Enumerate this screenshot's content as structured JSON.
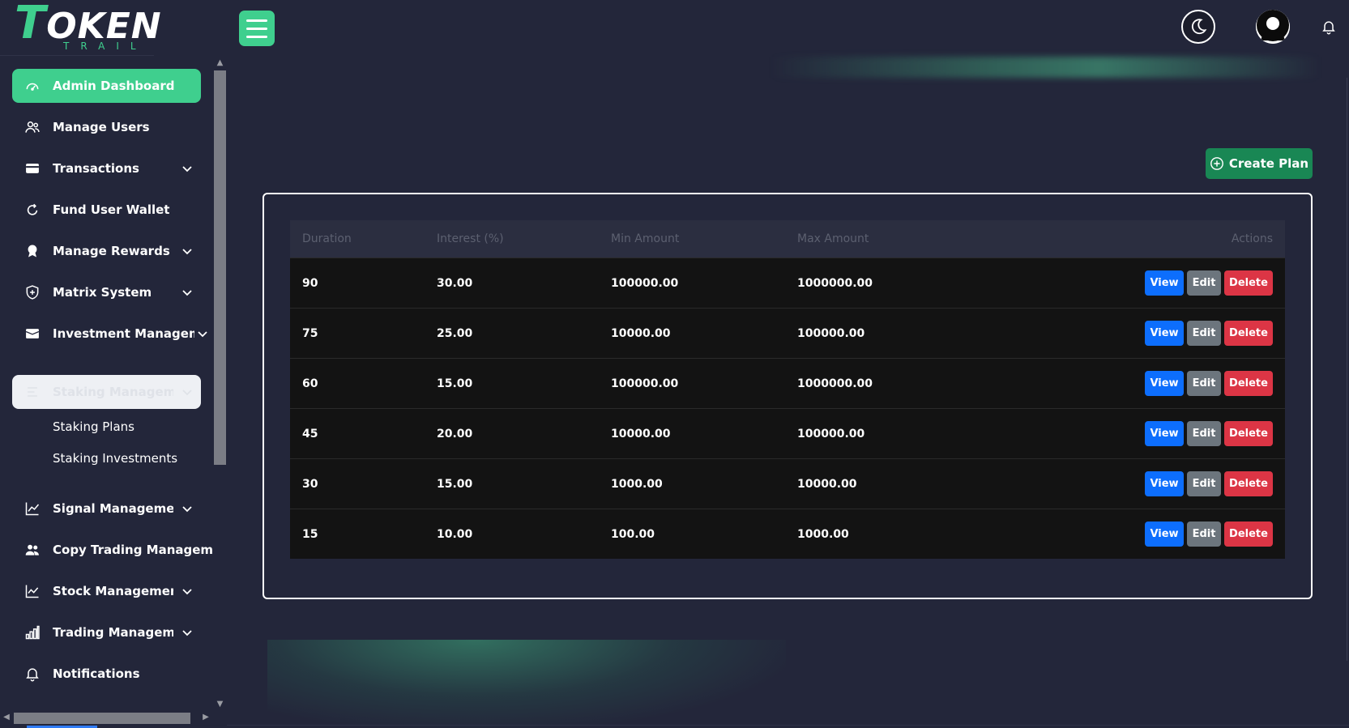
{
  "logo": {
    "main_first": "T",
    "main_rest": "OKEN",
    "sub": "TRAIL"
  },
  "sidebar": {
    "items": [
      {
        "label": "Admin Dashboard",
        "icon": "gauge-icon",
        "chevron": false
      },
      {
        "label": "Manage Users",
        "icon": "users-icon",
        "chevron": false
      },
      {
        "label": "Transactions",
        "icon": "credit-card-icon",
        "chevron": true
      },
      {
        "label": "Fund User Wallet",
        "icon": "refresh-icon",
        "chevron": false
      },
      {
        "label": "Manage Rewards",
        "icon": "award-icon",
        "chevron": true
      },
      {
        "label": "Matrix System",
        "icon": "shield-icon",
        "chevron": true
      },
      {
        "label": "Investment Management",
        "icon": "wallet-icon",
        "chevron": true
      },
      {
        "label": "Staking Management",
        "icon": "list-icon",
        "chevron": true
      },
      {
        "label": "Signal Management",
        "icon": "chart-line-icon",
        "chevron": true
      },
      {
        "label": "Copy Trading Management",
        "icon": "people-icon",
        "chevron": true
      },
      {
        "label": "Stock Management",
        "icon": "stock-chart-icon",
        "chevron": true
      },
      {
        "label": "Trading Management",
        "icon": "bar-chart-icon",
        "chevron": true
      },
      {
        "label": "Notifications",
        "icon": "bell-icon",
        "chevron": false
      }
    ],
    "submenu": [
      "Staking Plans",
      "Staking Investments"
    ]
  },
  "toolbar": {
    "create_label": "Create Plan"
  },
  "table": {
    "headers": [
      "Duration",
      "Interest (%)",
      "Min Amount",
      "Max Amount",
      "Actions"
    ],
    "rows": [
      [
        "90",
        "30.00",
        "100000.00",
        "1000000.00"
      ],
      [
        "75",
        "25.00",
        "10000.00",
        "100000.00"
      ],
      [
        "60",
        "15.00",
        "100000.00",
        "1000000.00"
      ],
      [
        "45",
        "20.00",
        "10000.00",
        "100000.00"
      ],
      [
        "30",
        "15.00",
        "1000.00",
        "10000.00"
      ],
      [
        "15",
        "10.00",
        "100.00",
        "1000.00"
      ]
    ],
    "actions": {
      "view": "View",
      "edit": "Edit",
      "delete": "Delete"
    }
  },
  "colors": {
    "accent": "#3fcf8e",
    "background": "#23263a",
    "create": "#198754",
    "view": "#0d6efd",
    "edit": "#6c757d",
    "delete": "#dc3545"
  }
}
